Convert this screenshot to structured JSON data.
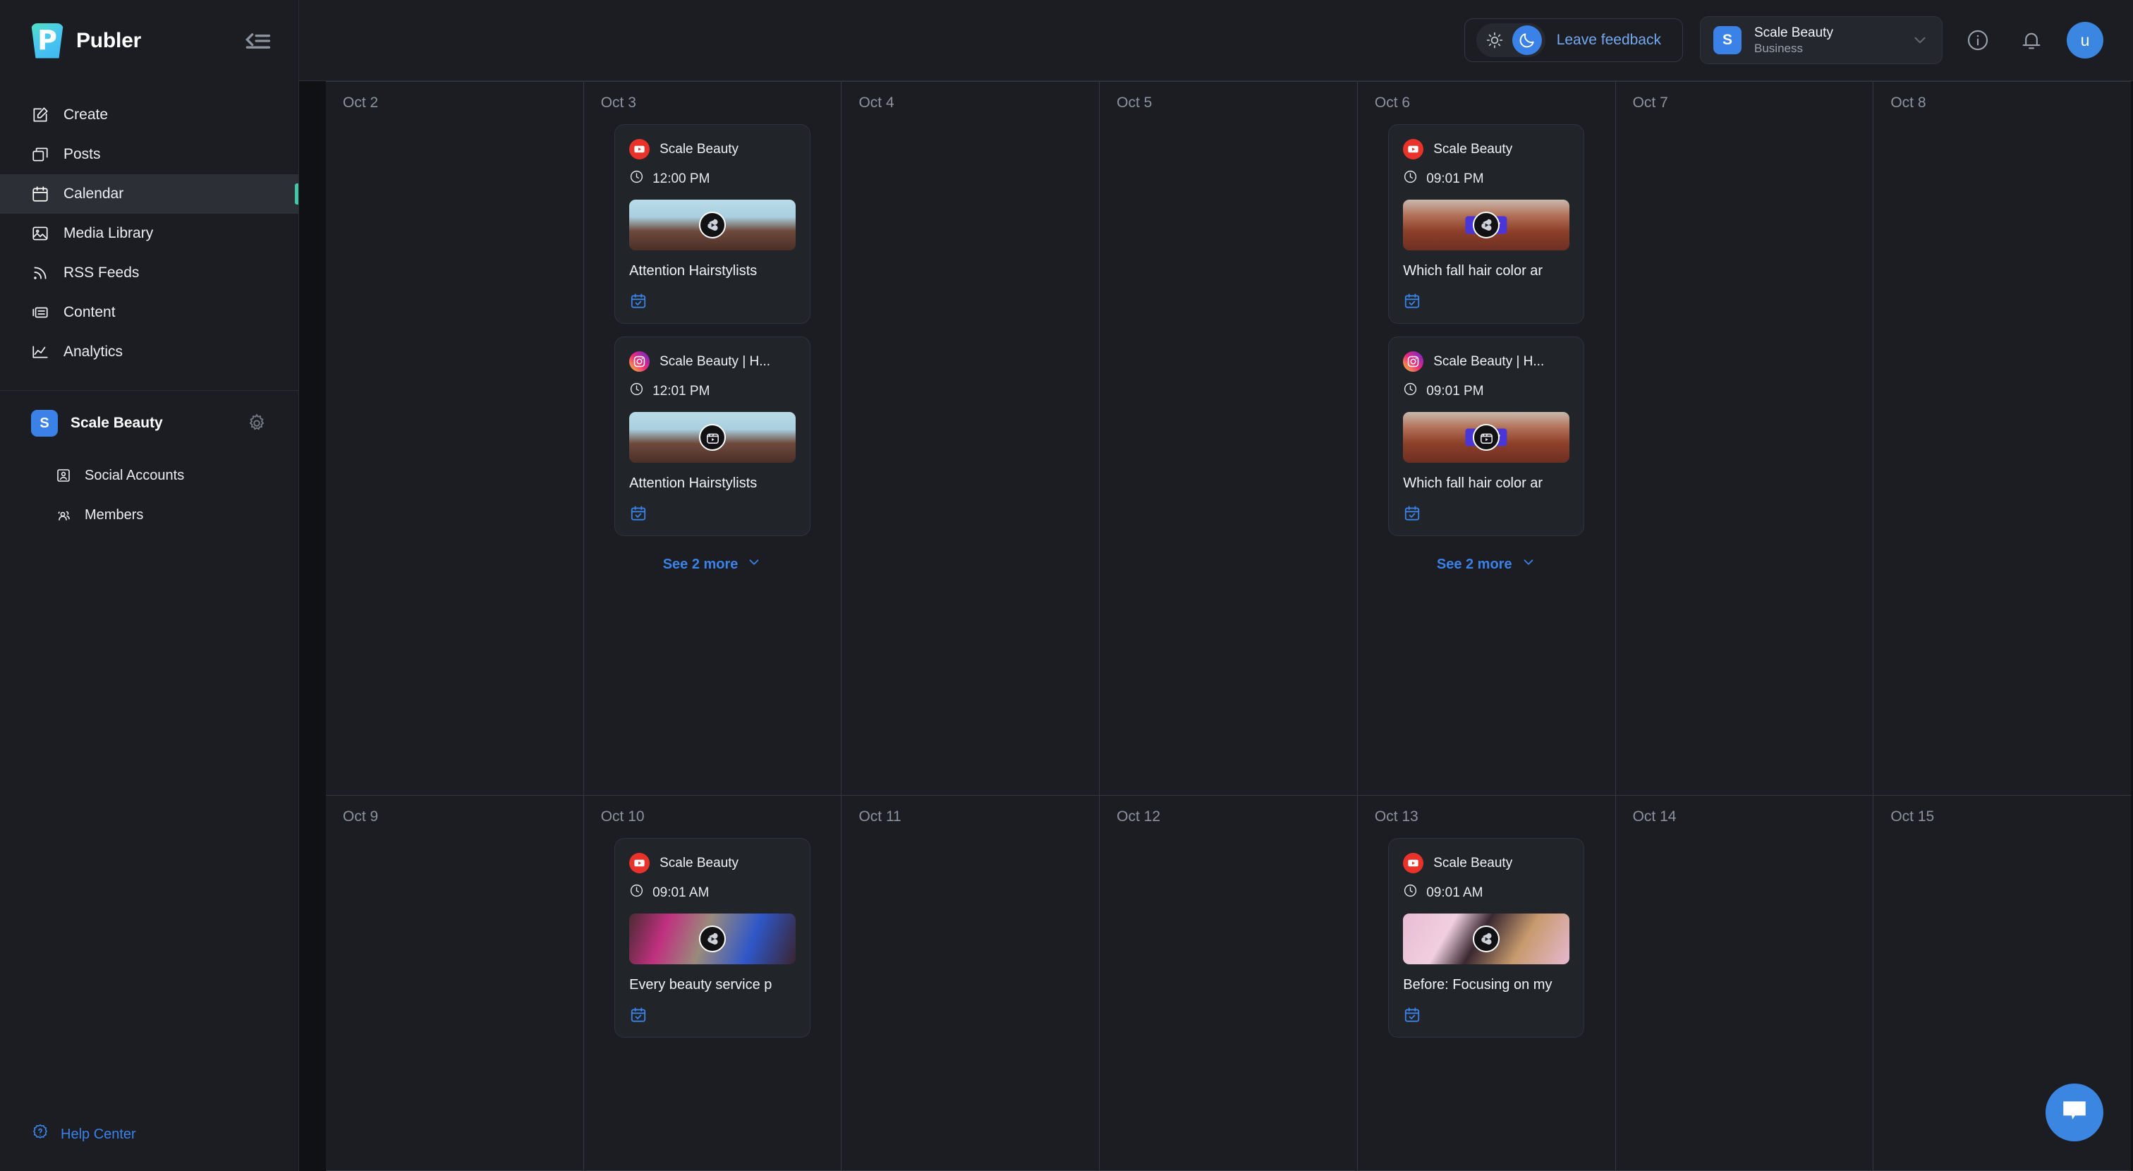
{
  "brand": {
    "name": "Publer",
    "logo_letter": "P"
  },
  "sidebar": {
    "nav": [
      {
        "label": "Create",
        "icon": "pencil-square-icon",
        "active": false
      },
      {
        "label": "Posts",
        "icon": "posts-stack-icon",
        "active": false
      },
      {
        "label": "Calendar",
        "icon": "calendar-icon",
        "active": true
      },
      {
        "label": "Media Library",
        "icon": "image-icon",
        "active": false
      },
      {
        "label": "RSS Feeds",
        "icon": "rss-icon",
        "active": false
      },
      {
        "label": "Content",
        "icon": "content-list-icon",
        "active": false
      },
      {
        "label": "Analytics",
        "icon": "analytics-line-icon",
        "active": false
      }
    ],
    "workspace": {
      "badge_letter": "S",
      "name": "Scale Beauty"
    },
    "sub_items": [
      {
        "label": "Social Accounts",
        "icon": "user-frame-icon"
      },
      {
        "label": "Members",
        "icon": "people-icon"
      }
    ],
    "help": {
      "label": "Help Center",
      "icon": "question-badge-icon"
    }
  },
  "topbar": {
    "theme": {
      "light_icon": "sun-icon",
      "dark_icon": "moon-icon",
      "active": "dark"
    },
    "feedback_label": "Leave feedback",
    "account": {
      "badge_letter": "S",
      "name": "Scale Beauty",
      "plan": "Business"
    },
    "info_icon": "info-circle-icon",
    "bell_icon": "bell-icon",
    "avatar_letter": "u"
  },
  "calendar": {
    "weeks": [
      {
        "days": [
          {
            "label": "Oct 2",
            "posts": [],
            "see_more": null
          },
          {
            "label": "Oct 3",
            "posts": [
              {
                "platform": "youtube",
                "account": "Scale Beauty",
                "time": "12:00 PM",
                "title": "Attention Hairstylists ",
                "media_badge": "youtube-shorts-icon",
                "status_icon": "calendar-check-icon",
                "thumb": "hair-braids-blue",
                "overlay_text": null
              },
              {
                "platform": "instagram",
                "account": "Scale Beauty | H...",
                "time": "12:01 PM",
                "title": "Attention Hairstylists ",
                "media_badge": "instagram-reels-icon",
                "status_icon": "calendar-check-icon",
                "thumb": "hair-braids-blue",
                "overlay_text": null
              }
            ],
            "see_more": "See 2 more"
          },
          {
            "label": "Oct 4",
            "posts": [],
            "see_more": null
          },
          {
            "label": "Oct 5",
            "posts": [],
            "see_more": null
          },
          {
            "label": "Oct 6",
            "posts": [
              {
                "platform": "youtube",
                "account": "Scale Beauty",
                "time": "09:01 PM",
                "title": "Which fall hair color ar",
                "media_badge": "youtube-shorts-icon",
                "status_icon": "calendar-check-icon",
                "thumb": "red-hair",
                "overlay_text": "Color"
              },
              {
                "platform": "instagram",
                "account": "Scale Beauty | H...",
                "time": "09:01 PM",
                "title": "Which fall hair color ar",
                "media_badge": "instagram-reels-icon",
                "status_icon": "calendar-check-icon",
                "thumb": "red-hair",
                "overlay_text": "Color"
              }
            ],
            "see_more": "See 2 more"
          },
          {
            "label": "Oct 7",
            "posts": [],
            "see_more": null
          },
          {
            "label": "Oct 8",
            "posts": [],
            "see_more": null
          }
        ]
      },
      {
        "days": [
          {
            "label": "Oct 9",
            "posts": [],
            "see_more": null
          },
          {
            "label": "Oct 10",
            "posts": [
              {
                "platform": "youtube",
                "account": "Scale Beauty",
                "time": "09:01 AM",
                "title": "Every beauty service p",
                "media_badge": "youtube-shorts-icon",
                "status_icon": "calendar-check-icon",
                "thumb": "salon-pink",
                "overlay_text": null
              }
            ],
            "see_more": null
          },
          {
            "label": "Oct 11",
            "posts": [],
            "see_more": null
          },
          {
            "label": "Oct 12",
            "posts": [],
            "see_more": null
          },
          {
            "label": "Oct 13",
            "posts": [
              {
                "platform": "youtube",
                "account": "Scale Beauty",
                "time": "09:01 AM",
                "title": "Before: Focusing on my",
                "media_badge": "youtube-shorts-icon",
                "status_icon": "calendar-check-icon",
                "thumb": "lashes-pink",
                "overlay_text": null
              }
            ],
            "see_more": null
          },
          {
            "label": "Oct 14",
            "posts": [],
            "see_more": null
          },
          {
            "label": "Oct 15",
            "posts": [],
            "see_more": null
          }
        ]
      }
    ]
  },
  "chat_fab": {
    "icon": "chat-bubble-icon"
  },
  "colors": {
    "accent_blue": "#3b82e8",
    "active_marker_green": "#43c6a8",
    "youtube_red": "#e8322a",
    "status_blue": "#3b82e8",
    "overlay_purple": "#4a35d6",
    "sidebar_bg": "#1b1d22",
    "grid_bg": "#1b1d22",
    "grid_line": "#33373e"
  }
}
